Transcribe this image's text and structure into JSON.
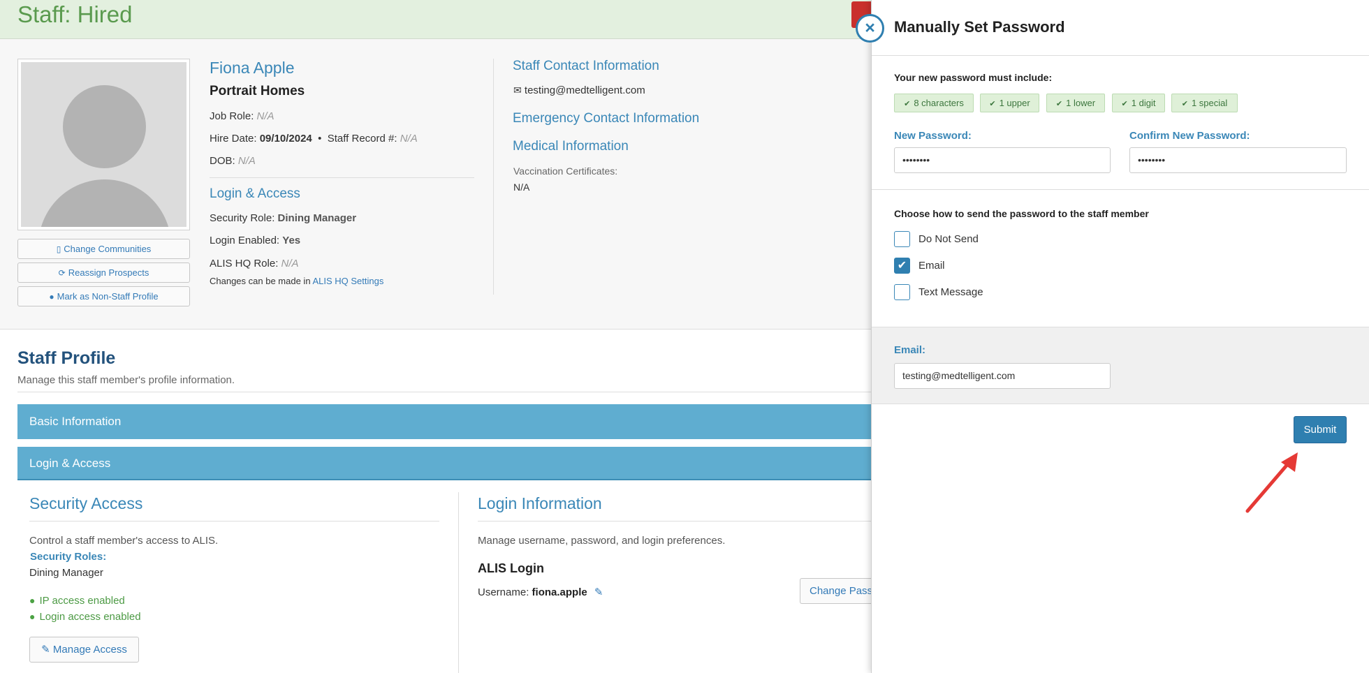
{
  "header": {
    "title": "Staff: Hired"
  },
  "profile": {
    "name": "Fiona Apple",
    "company": "Portrait Homes",
    "job_role_label": "Job Role:",
    "job_role_value": "N/A",
    "hire_date_label": "Hire Date:",
    "hire_date_value": "09/10/2024",
    "separator": "•",
    "staff_record_label": "Staff Record #:",
    "staff_record_value": "N/A",
    "dob_label": "DOB:",
    "dob_value": "N/A",
    "buttons": {
      "change_communities": "Change Communities",
      "reassign_prospects": "Reassign Prospects",
      "mark_non_staff": "Mark as Non-Staff Profile"
    },
    "login_access": {
      "heading": "Login & Access",
      "security_role_label": "Security Role:",
      "security_role_value": "Dining Manager",
      "login_enabled_label": "Login Enabled:",
      "login_enabled_value": "Yes",
      "alis_hq_role_label": "ALIS HQ Role:",
      "alis_hq_role_value": "N/A",
      "changes_note": "Changes can be made in",
      "changes_link": "ALIS HQ Settings"
    },
    "contact": {
      "heading": "Staff Contact Information",
      "email": "testing@medtelligent.com",
      "emergency_heading": "Emergency Contact Information",
      "medical_heading": "Medical Information",
      "vaccination_label": "Vaccination Certificates:",
      "vaccination_value": "N/A"
    }
  },
  "staff_profile": {
    "title": "Staff Profile",
    "subtitle": "Manage this staff member's profile information.",
    "bars": {
      "basic": "Basic Information",
      "login": "Login & Access"
    },
    "security": {
      "heading": "Security Access",
      "desc": "Control a staff member's access to ALIS.",
      "roles_label": "Security Roles:",
      "roles_value": "Dining Manager",
      "ip_access": "IP access enabled",
      "login_access": "Login access enabled",
      "manage_button": "Manage Access"
    },
    "login_info": {
      "heading": "Login Information",
      "desc": "Manage username, password, and login preferences.",
      "alis_login": "ALIS Login",
      "username_label": "Username:",
      "username_value": "fiona.apple",
      "change_button": "Change Pass"
    }
  },
  "drawer": {
    "title": "Manually Set Password",
    "requirements_label": "Your new password must include:",
    "requirements": [
      "8 characters",
      "1 upper",
      "1 lower",
      "1 digit",
      "1 special"
    ],
    "new_password_label": "New Password:",
    "new_password_value": "••••••••",
    "confirm_password_label": "Confirm New Password:",
    "confirm_password_value": "••••••••",
    "send_label": "Choose how to send the password to the staff member",
    "options": {
      "do_not_send": "Do Not Send",
      "email": "Email",
      "text_message": "Text Message"
    },
    "email_label": "Email:",
    "email_value": "testing@medtelligent.com",
    "submit": "Submit"
  }
}
